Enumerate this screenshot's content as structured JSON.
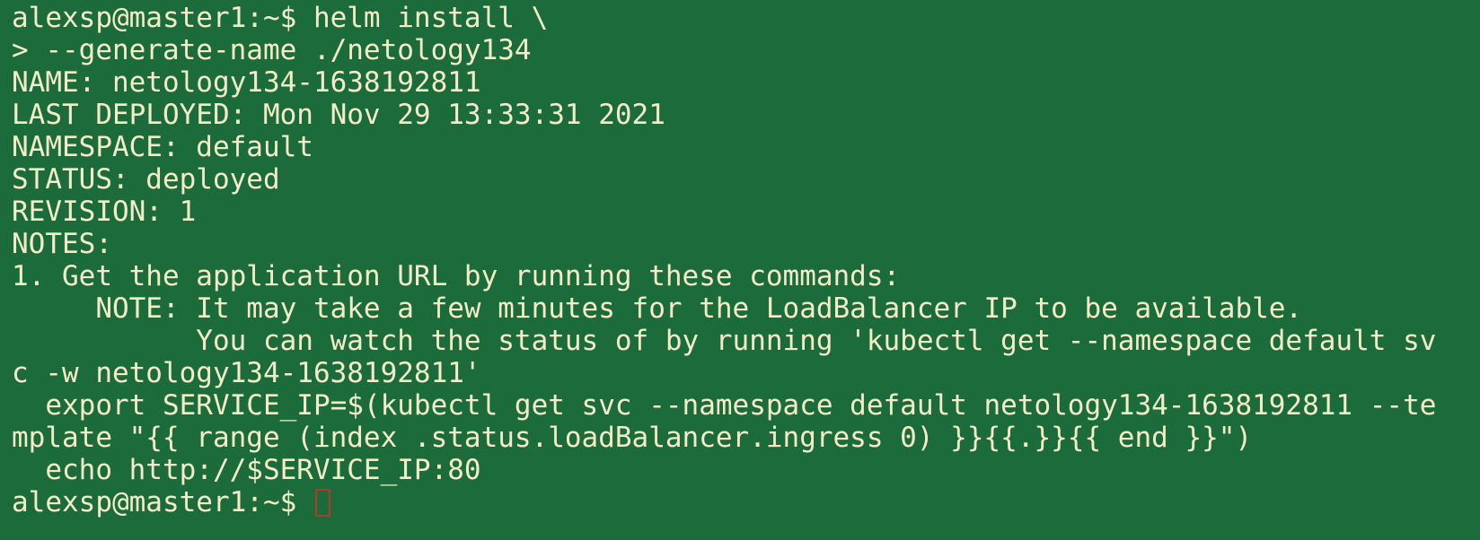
{
  "terminal": {
    "lines": [
      "alexsp@master1:~$ helm install \\",
      "> --generate-name ./netology134",
      "NAME: netology134-1638192811",
      "LAST DEPLOYED: Mon Nov 29 13:33:31 2021",
      "NAMESPACE: default",
      "STATUS: deployed",
      "REVISION: 1",
      "NOTES:",
      "1. Get the application URL by running these commands:",
      "     NOTE: It may take a few minutes for the LoadBalancer IP to be available.",
      "           You can watch the status of by running 'kubectl get --namespace default sv",
      "c -w netology134-1638192811'",
      "  export SERVICE_IP=$(kubectl get svc --namespace default netology134-1638192811 --te",
      "mplate \"{{ range (index .status.loadBalancer.ingress 0) }}{{.}}{{ end }}\")",
      "  echo http://$SERVICE_IP:80"
    ],
    "prompt": "alexsp@master1:~$ "
  },
  "colors": {
    "background": "#1b6c3a",
    "text": "#f3ecc8",
    "cursor": "#b23a2a"
  }
}
